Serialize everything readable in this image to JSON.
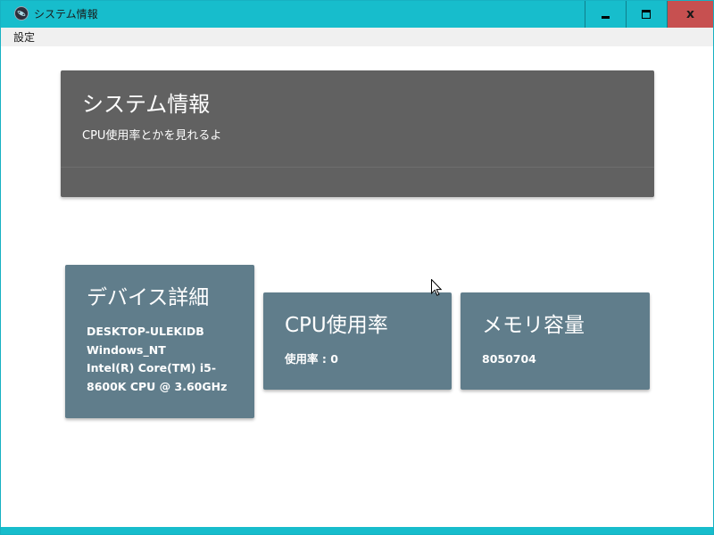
{
  "window": {
    "title": "システム情報",
    "controls": {
      "minimize": "minimize",
      "maximize": "maximize",
      "close": "x"
    }
  },
  "menu": {
    "items": [
      {
        "label": "設定"
      }
    ]
  },
  "header": {
    "title": "システム情報",
    "subtitle": "CPU使用率とかを見れるよ"
  },
  "cards": {
    "device": {
      "title": "デバイス詳細",
      "lines": [
        "DESKTOP-ULEKIDB",
        "Windows_NT",
        "Intel(R) Core(TM) i5-",
        "8600K CPU @ 3.60GHz"
      ]
    },
    "cpu": {
      "title": "CPU使用率",
      "value_text": "使用率 : 0"
    },
    "memory": {
      "title": "メモリ容量",
      "value_text": "8050704"
    }
  },
  "colors": {
    "titlebar": "#17bdcc",
    "close_button": "#c75050",
    "header_card": "#616161",
    "info_card": "#607d8b"
  },
  "icons": {
    "app": "electron-app-icon",
    "cursor": "mouse-pointer-icon"
  }
}
